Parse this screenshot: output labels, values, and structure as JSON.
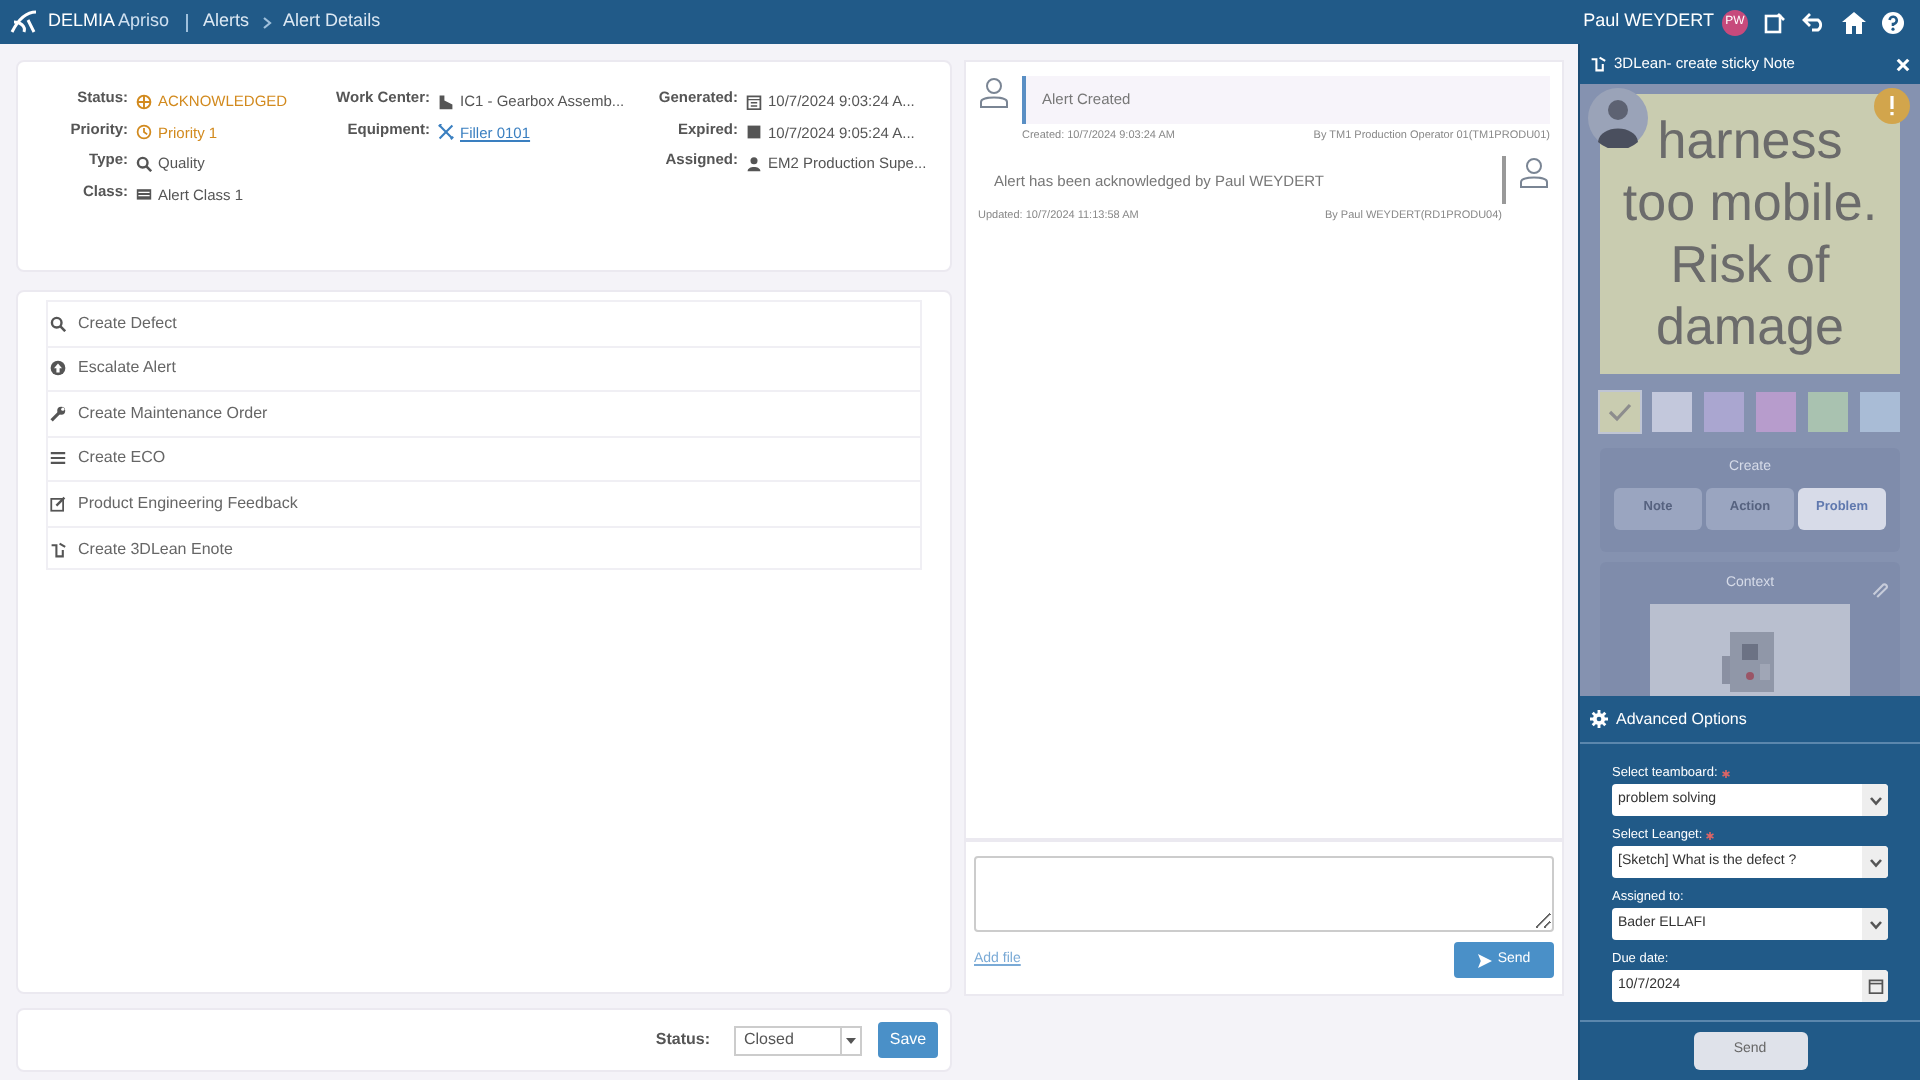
{
  "header": {
    "brand": "DELMIA",
    "app": "Apriso",
    "breadcrumbs": [
      {
        "label": "Alerts"
      },
      {
        "label": "Alert Details"
      }
    ],
    "user": "Paul WEYDERT",
    "initials": "PW"
  },
  "details": {
    "columns": [
      [
        {
          "label": "Status:",
          "value": "ACKNOWLEDGED",
          "kind": "warning"
        },
        {
          "label": "Priority:",
          "value": "Priority 1",
          "kind": "warning"
        },
        {
          "label": "Type:",
          "value": "Quality",
          "kind": "plain"
        },
        {
          "label": "Class:",
          "value": "Alert Class 1",
          "kind": "plain"
        }
      ],
      [
        {
          "label": "Work Center:",
          "value": "IC1 - Gearbox Assemb...",
          "kind": "plain"
        },
        {
          "label": "Equipment:",
          "value": "Filler 0101",
          "kind": "link"
        }
      ],
      [
        {
          "label": "Generated:",
          "value": "10/7/2024 9:03:24 A...",
          "kind": "plain"
        },
        {
          "label": "Expired:",
          "value": "10/7/2024 9:05:24 A...",
          "kind": "plain"
        },
        {
          "label": "Assigned:",
          "value": "EM2 Production Supe...",
          "kind": "plain"
        }
      ]
    ]
  },
  "actions": [
    {
      "label": "Create Defect"
    },
    {
      "label": "Escalate Alert"
    },
    {
      "label": "Create Maintenance Order"
    },
    {
      "label": "Create ECO"
    },
    {
      "label": "Product Engineering Feedback"
    },
    {
      "label": "Create 3DLean Enote"
    }
  ],
  "timeline": [
    {
      "kind": "left",
      "text": "Alert Created",
      "time": "Created: 10/7/2024 9:03:24 AM",
      "author": "By TM1 Production Operator 01(TM1PRODU01)"
    },
    {
      "kind": "right",
      "text": "Alert has been acknowledged by Paul WEYDERT",
      "time": "Updated: 10/7/2024 11:13:58 AM",
      "author": "By Paul WEYDERT(RD1PRODU04)"
    }
  ],
  "comment": {
    "add_file": "Add file",
    "send": "Send"
  },
  "footer": {
    "status_label": "Status:",
    "status_value": "Closed",
    "save": "Save"
  },
  "sticky": {
    "title": "3DLean- create sticky Note",
    "note_text": "harness too mobile. Risk of damage",
    "swatches": [
      {
        "color": "#c9ccb0",
        "selected": true
      },
      {
        "color": "#c3c8dc",
        "selected": false
      },
      {
        "color": "#aaa6d0",
        "selected": false
      },
      {
        "color": "#b79ccc",
        "selected": false
      },
      {
        "color": "#a9c2b0",
        "selected": false
      },
      {
        "color": "#a9bcd6",
        "selected": false
      }
    ],
    "create_label": "Create",
    "types": [
      {
        "label": "Note",
        "selected": false
      },
      {
        "label": "Action",
        "selected": false
      },
      {
        "label": "Problem",
        "selected": true
      }
    ],
    "context_label": "Context",
    "advanced_title": "Advanced Options",
    "fields": [
      {
        "kind": "select",
        "label": "Select teamboard:",
        "required": true,
        "value": "problem solving"
      },
      {
        "kind": "select",
        "label": "Select Leanget:",
        "required": true,
        "value": "[Sketch] What is the defect ?"
      },
      {
        "kind": "select",
        "label": "Assigned to:",
        "required": false,
        "value": "Bader ELLAFI"
      },
      {
        "kind": "date",
        "label": "Due date:",
        "required": false,
        "value": "10/7/2024"
      }
    ],
    "send": "Send"
  }
}
